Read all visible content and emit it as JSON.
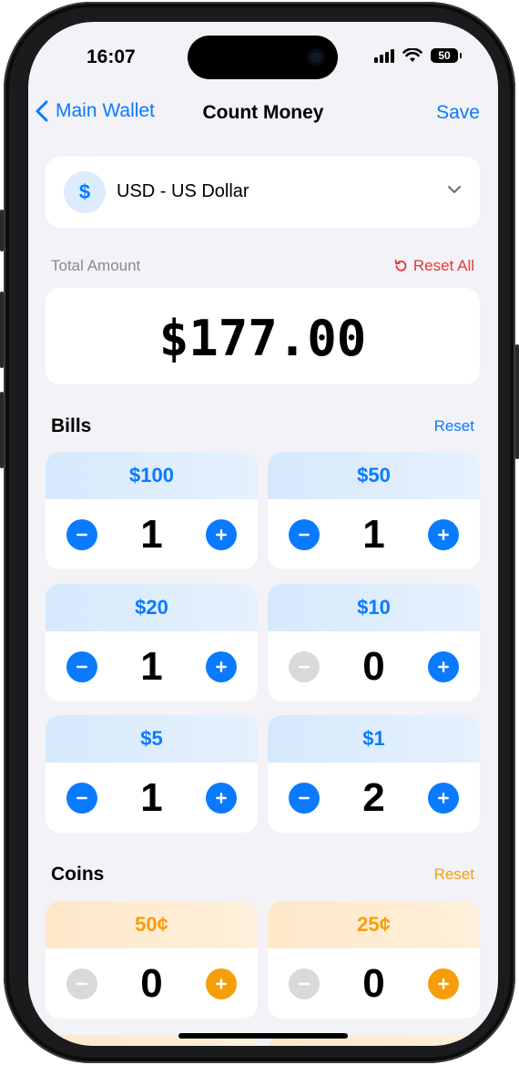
{
  "status_bar": {
    "time": "16:07",
    "battery": "50"
  },
  "nav": {
    "back_label": "Main Wallet",
    "title": "Count Money",
    "save_label": "Save"
  },
  "currency": {
    "symbol": "$",
    "label": "USD - US Dollar"
  },
  "total": {
    "label": "Total Amount",
    "reset_all_label": "Reset All",
    "value": "$177.00"
  },
  "bills": {
    "title": "Bills",
    "reset_label": "Reset",
    "items": [
      {
        "denomination": "$100",
        "count": "1"
      },
      {
        "denomination": "$50",
        "count": "1"
      },
      {
        "denomination": "$20",
        "count": "1"
      },
      {
        "denomination": "$10",
        "count": "0"
      },
      {
        "denomination": "$5",
        "count": "1"
      },
      {
        "denomination": "$1",
        "count": "2"
      }
    ]
  },
  "coins": {
    "title": "Coins",
    "reset_label": "Reset",
    "items": [
      {
        "denomination": "50¢",
        "count": "0"
      },
      {
        "denomination": "25¢",
        "count": "0"
      }
    ]
  },
  "colors": {
    "accent_blue": "#0a7aff",
    "coin_orange": "#f59e0b",
    "reset_red": "#e53935",
    "background": "#f2f2f7"
  },
  "icons": [
    "chevron-left-icon",
    "chevron-down-icon",
    "reset-icon",
    "minus-icon",
    "plus-icon",
    "wifi-icon",
    "signal-icon",
    "battery-icon"
  ]
}
